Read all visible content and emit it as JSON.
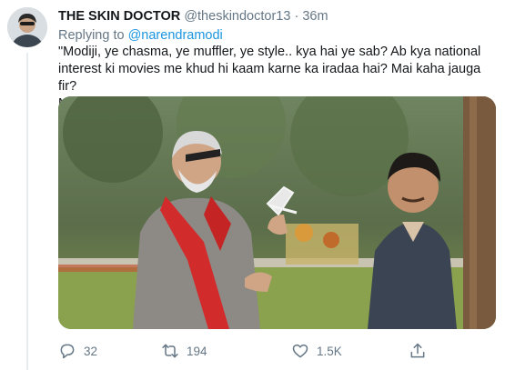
{
  "tweet": {
    "display_name": "THE SKIN DOCTOR",
    "handle": "@theskindoctor13",
    "separator": "·",
    "time": "36m",
    "reply_prefix": "Replying to",
    "reply_to": "@narendramodi",
    "text": "\"Modiji, ye chasma, ye muffler, ye style.. kya hai ye sab? Ab kya national\ninterest ki movies me khud hi kaam karne ka iradaa hai? Mai kaha jauga fir?\nModiji? Arre dekhiye to sahi idhar, pose baad me de lena.\""
  },
  "actions": {
    "reply_count": "32",
    "retweet_count": "194",
    "like_count": "1.5K"
  },
  "icons": {
    "reply": "reply-icon",
    "retweet": "retweet-icon",
    "like": "heart-icon",
    "share": "share-icon"
  },
  "colors": {
    "text": "#14171a",
    "muted": "#657786",
    "link": "#1b95e0"
  }
}
